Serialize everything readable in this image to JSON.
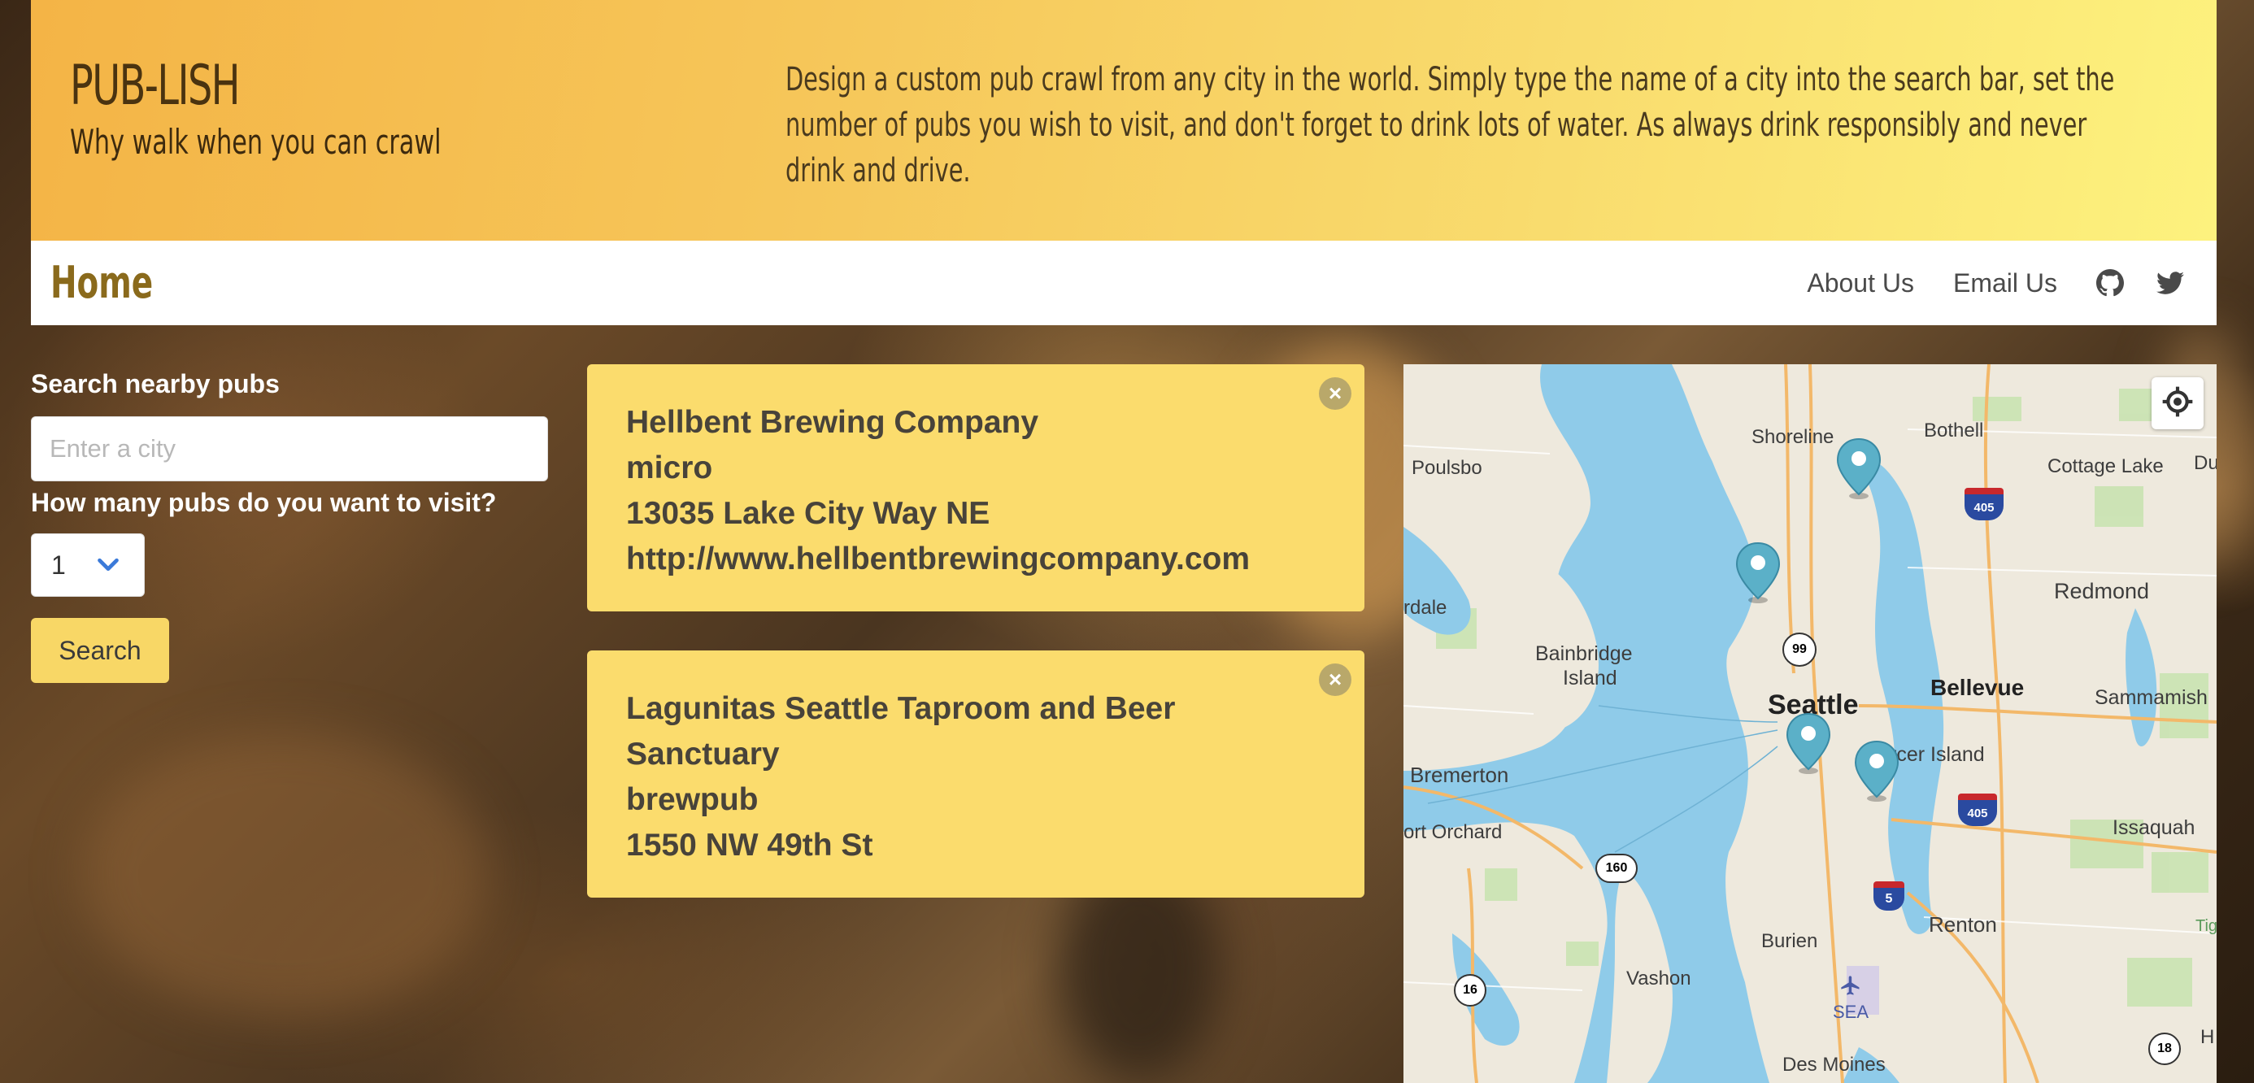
{
  "header": {
    "title": "PUB-LISH",
    "tagline": "Why walk when you can crawl",
    "description": "Design a custom pub crawl from any city in the world. Simply type the name of a city into the search bar, set the number of pubs you wish to visit, and don't forget to drink lots of water. As always drink responsibly and never drink and drive."
  },
  "nav": {
    "home": "Home",
    "about": "About Us",
    "email": "Email Us",
    "github_icon": "github-icon",
    "twitter_icon": "twitter-icon"
  },
  "search": {
    "label": "Search nearby pubs",
    "placeholder": "Enter a city",
    "value": "",
    "count_label": "How many pubs do you want to visit?",
    "count_value": "1",
    "button": "Search"
  },
  "results": [
    {
      "name": "Hellbent Brewing Company",
      "type": "micro",
      "address": "13035 Lake City Way NE",
      "url": "http://www.hellbentbrewingcompany.com"
    },
    {
      "name": "Lagunitas Seattle Taproom and Beer",
      "name_line2": "Sanctuary",
      "type": "brewpub",
      "address": "1550 NW 49th St"
    }
  ],
  "map": {
    "labels": {
      "shoreline": "Shoreline",
      "bothell": "Bothell",
      "poulsbo": "Poulsbo",
      "cottage_lake": "Cottage Lake",
      "du": "Du",
      "redmond": "Redmond",
      "rdale": "rdale",
      "bainbridge": "Bainbridge",
      "island": "Island",
      "seattle": "Seattle",
      "bellevue": "Bellevue",
      "sammamish": "Sammamish",
      "mercer": "rcer Island",
      "bremerton": "Bremerton",
      "port_orchard": "ort Orchard",
      "issaquah": "Issaquah",
      "renton": "Renton",
      "burien": "Burien",
      "vashon": "Vashon",
      "sea": "SEA",
      "des_moines": "Des Moines",
      "tig": "Tig",
      "h": "H"
    },
    "shields": {
      "r99": "99",
      "r160": "160",
      "r16": "16",
      "r18": "18",
      "i405a": "405",
      "i405b": "405",
      "i5": "5"
    }
  }
}
